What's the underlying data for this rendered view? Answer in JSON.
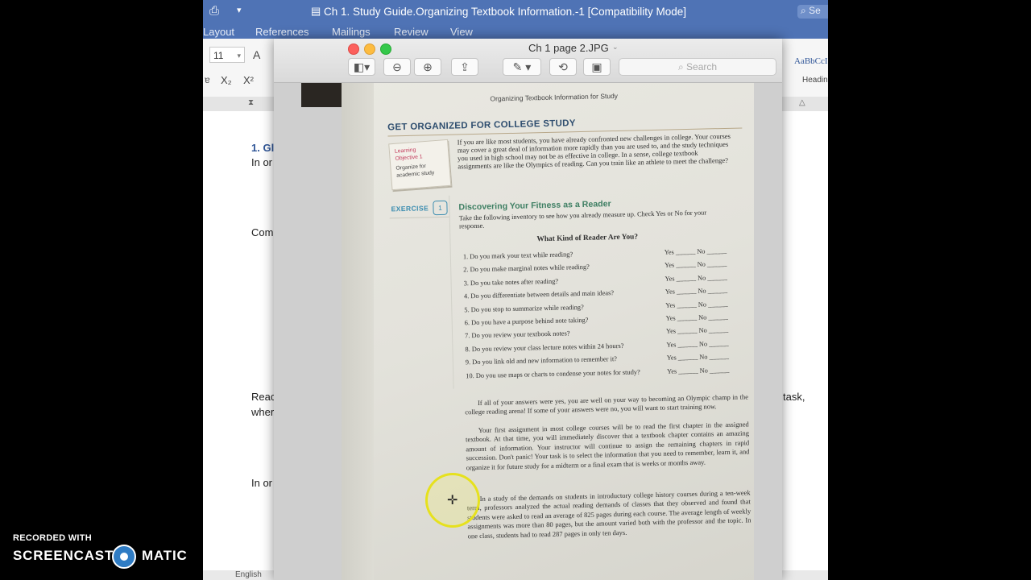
{
  "word": {
    "title": "Ch 1. Study Guide.Organizing Textbook Information.-1 [Compatibility Mode]",
    "search_placeholder": "Se",
    "tabs": [
      "Layout",
      "References",
      "Mailings",
      "Review",
      "View"
    ],
    "font_size": "11",
    "style_preview": "AaBbCcI",
    "style_name": "Headin",
    "doc_lines": {
      "heading": "1. Gl",
      "line1": "In or",
      "line2": "Com",
      "line3": "Reac",
      "line4": "wher",
      "line5": "In or",
      "right_fragment": "task,"
    },
    "status_lang": "English"
  },
  "preview": {
    "title": "Ch 1 page 2.JPG",
    "search_placeholder": "Search",
    "page": {
      "running_head": "Organizing Textbook Information for Study",
      "chapter_heading": "GET ORGANIZED FOR COLLEGE STUDY",
      "learning_objective": {
        "line1": "Learning",
        "line2": "Objective 1",
        "line3": "Organize for",
        "line4": "academic study"
      },
      "intro": "If you are like most students, you have already confronted new challenges in college. Your courses may cover a great deal of information more rapidly than you are used to, and the study techniques you used in high school may not be as effective in college. In a sense, college textbook assignments are like the Olympics of reading. Can you train like an athlete to meet the challenge?",
      "exercise_label": "EXERCISE",
      "exercise_number": "1",
      "exercise_title": "Discovering Your Fitness as a Reader",
      "instructions": "Take the following inventory to see how you already measure up. Check Yes or No for your response.",
      "inventory_title": "What Kind of Reader Are You?",
      "questions": [
        "1.  Do you mark your text while reading?",
        "2.  Do you make marginal notes while reading?",
        "3.  Do you take notes after reading?",
        "4.  Do you differentiate between details and main ideas?",
        "5.  Do you stop to summarize while reading?",
        "6.  Do you have a purpose behind note taking?",
        "7.  Do you review your textbook notes?",
        "8.  Do you review your class lecture notes within 24 hours?",
        "9.  Do you link old and new information to remember it?",
        "10. Do you use maps or charts to condense your notes for study?"
      ],
      "yes_no": "Yes ______  No ______",
      "para1": "If all of your answers were yes, you are well on your way to becoming an Olympic champ in the college reading arena! If some of your answers were no, you will want to start training now.",
      "para2": "Your first assignment in most college courses will be to read the first chapter in the assigned textbook. At that time, you will immediately discover that a textbook chapter contains an amazing amount of information. Your instructor will continue to assign the remaining chapters in rapid succession. Don't panic! Your task is to select the information that you need to remember, learn it, and organize it for future study for a midterm or a final exam that is weeks or months away.",
      "para3": "In a study of the demands on students in introductory college history courses during a ten-week term, professors analyzed the actual reading demands of classes that they observed and found that students were asked to read an average of 825 pages during each course. The average length of weekly assignments was more than 80 pages, but the amount varied both with the professor and the topic. In one class, students had to read 287 pages in only ten days."
    }
  },
  "watermark": {
    "recorded": "RECORDED WITH",
    "brand_left": "SCREENCAST",
    "brand_right": "MATIC"
  },
  "colors": {
    "word_blue": "#4f73b5",
    "exercise_teal": "#3c8db0",
    "exercise_title_green": "#3e7f63",
    "cursor_highlight": "#e6e114"
  }
}
